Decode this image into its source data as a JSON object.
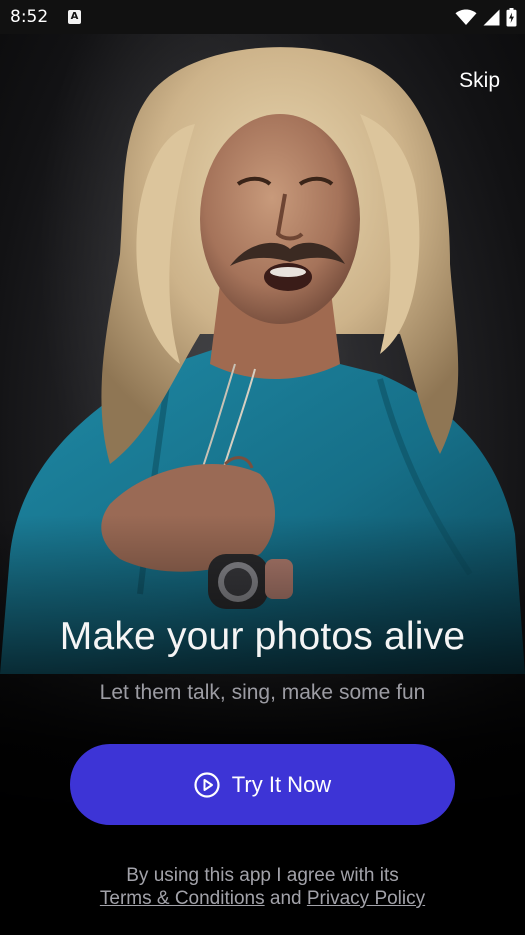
{
  "status_bar": {
    "time": "8:52",
    "app_icon_letter": "A",
    "icons": [
      "wifi-icon",
      "cellular-signal-icon",
      "battery-icon"
    ]
  },
  "header": {
    "skip_label": "Skip"
  },
  "hero": {
    "image": "portrait-photo"
  },
  "main": {
    "title": "Make your photos alive",
    "subtitle": "Let them talk, sing, make some fun"
  },
  "cta": {
    "label": "Try It Now",
    "icon": "play-circle-icon",
    "color": "#3d34d6"
  },
  "legal": {
    "line1": "By using this app I agree with its",
    "terms_label": "Terms & Conditions",
    "and": "and",
    "privacy_label": "Privacy Policy"
  }
}
